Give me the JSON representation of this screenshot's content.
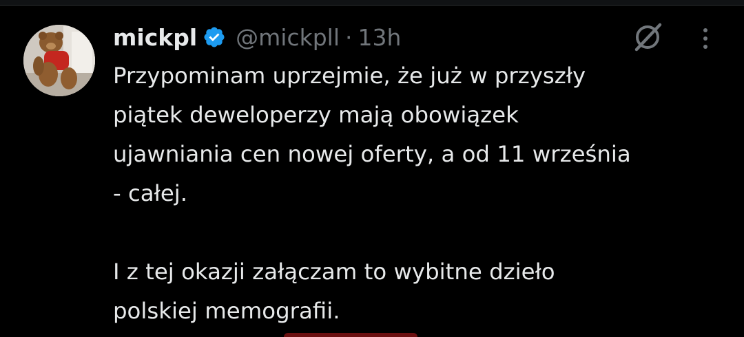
{
  "tweet": {
    "author_name": "mickpl",
    "handle": "@mickpll",
    "separator": "·",
    "timestamp": "13h",
    "verified": true,
    "paragraph1": [
      "Przypominam uprzejmie, że już w przyszły",
      "piątek deweloperzy mają obowiązek",
      "ujawniania cen nowej oferty, a od 11 września",
      "- całej."
    ],
    "paragraph2": [
      "I z tej okazji załączam to wybitne dzieło",
      "polskiej memografii."
    ]
  },
  "icons": {
    "verified": "verified-badge-icon",
    "grok": "grok-icon",
    "more": "more-vertical-icon"
  },
  "colors": {
    "background": "#000000",
    "text_primary": "#e7e9ea",
    "text_secondary": "#71767b",
    "verified_blue": "#1d9bf0"
  }
}
